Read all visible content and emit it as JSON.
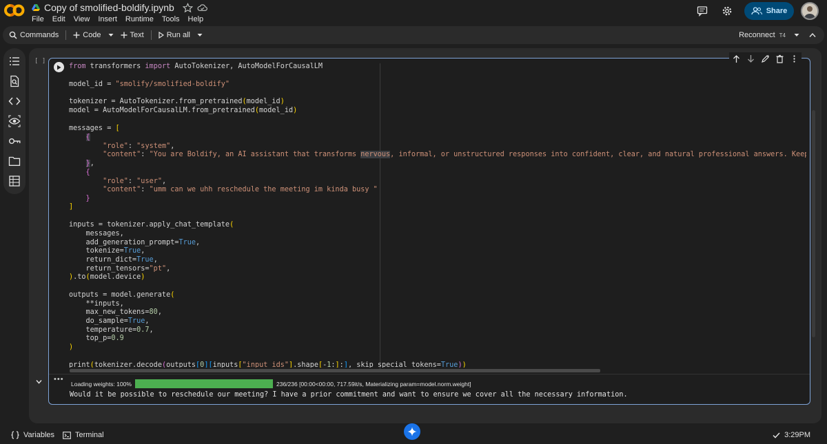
{
  "app": {
    "title": "Copy of smolified-boldify.ipynb",
    "menu": [
      "File",
      "Edit",
      "View",
      "Insert",
      "Runtime",
      "Tools",
      "Help"
    ],
    "share_label": "Share"
  },
  "toolbar": {
    "commands_label": "Commands",
    "code_label": "Code",
    "text_label": "Text",
    "run_all_label": "Run all",
    "reconnect_label": "Reconnect",
    "runtime_type": "T4"
  },
  "cell": {
    "bracket": "[ ]",
    "code_lines": [
      "from transformers import AutoTokenizer, AutoModelForCausalLM",
      "",
      "model_id = \"smolify/smolified-boldify\"",
      "",
      "tokenizer = AutoTokenizer.from_pretrained(model_id)",
      "model = AutoModelForCausalLM.from_pretrained(model_id)",
      "",
      "messages = [",
      "    {",
      "        \"role\": \"system\",",
      "        \"content\": \"You are Boldify, an AI assistant that transforms nervous, informal, or unstructured responses into confident, clear, and natural professional answers. Keep the original m",
      "    },",
      "    {",
      "        \"role\": \"user\",",
      "        \"content\": \"umm can we uhh reschedule the meeting im kinda busy \"",
      "    }",
      "]",
      "",
      "inputs = tokenizer.apply_chat_template(",
      "    messages,",
      "    add_generation_prompt=True,",
      "    tokenize=True,",
      "    return_dict=True,",
      "    return_tensors=\"pt\",",
      ").to(model.device)",
      "",
      "outputs = model.generate(",
      "    **inputs,",
      "    max_new_tokens=80,",
      "    do_sample=True,",
      "    temperature=0.7,",
      "    top_p=0.9",
      ")",
      "",
      "print(tokenizer.decode(outputs[0][inputs[\"input_ids\"].shape[-1]:], skip_special_tokens=True))"
    ]
  },
  "output": {
    "menu_icon": "•••",
    "loading_label": "Loading weights: 100%",
    "progress_fraction": 1.0,
    "progress_text": "236/236 [00:00<00:00, 717.59it/s, Materializing param=model.norm.weight]",
    "result_text": "Would it be possible to reschedule our meeting? I have a prior commitment and want to ensure we cover all the necessary information."
  },
  "statusbar": {
    "variables_label": "Variables",
    "terminal_label": "Terminal",
    "time": "3:29PM"
  },
  "colors": {
    "accent": "#7fa4d8",
    "progress": "#4caf50",
    "share_bg": "#004a77",
    "logo": "#f9ab00"
  },
  "icons": [
    "colab-logo",
    "drive-icon",
    "star-icon",
    "cloud-icon",
    "comment-icon",
    "gear-icon",
    "people-icon",
    "avatar",
    "search-icon",
    "plus-icon",
    "play-icon",
    "chevron-down-icon",
    "toc-icon",
    "find-icon",
    "code-icon",
    "variables-eye-icon",
    "key-icon",
    "folder-icon",
    "table-icon",
    "arrow-up-icon",
    "arrow-down-icon",
    "edit-icon",
    "trash-icon",
    "more-icon",
    "collapse-icon",
    "gemini-icon",
    "check-icon",
    "terminal-icon",
    "braces-icon"
  ]
}
